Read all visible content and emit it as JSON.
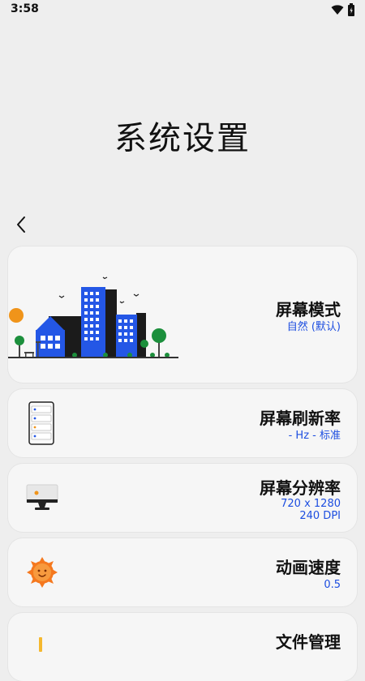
{
  "status": {
    "time": "3:58"
  },
  "header": {
    "title": "系统设置"
  },
  "settings": [
    {
      "title": "屏幕模式",
      "value": "自然 (默认)"
    },
    {
      "title": "屏幕刷新率",
      "value": "- Hz - 标准"
    },
    {
      "title": "屏幕分辨率",
      "value": "720 x 1280",
      "value2": "240 DPI"
    },
    {
      "title": "动画速度",
      "value": "0.5"
    },
    {
      "title": "文件管理"
    }
  ],
  "colors": {
    "accent": "#1d4ee0",
    "card": "#f6f6f6",
    "background": "#eeeeee"
  },
  "icons": [
    "wifi-icon",
    "battery-icon",
    "back-arrow-icon",
    "city-illustration",
    "phone-list-icon",
    "monitor-icon",
    "sun-icon",
    "file-icon"
  ]
}
